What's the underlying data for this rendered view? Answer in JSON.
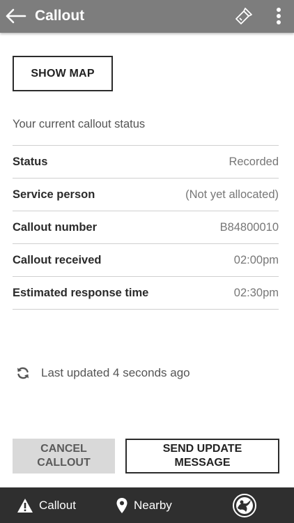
{
  "app_bar": {
    "title": "Callout",
    "back_icon": "arrow-left-icon",
    "torch_icon": "flashlight-icon",
    "more_icon": "more-vert-icon",
    "background": "#7d7d7d"
  },
  "actions": {
    "show_map": "SHOW MAP",
    "cancel_callout": "CANCEL\nCALLOUT",
    "send_update": "SEND UPDATE\nMESSAGE"
  },
  "status": {
    "intro": "Your current callout status",
    "rows": [
      {
        "label": "Status",
        "value": "Recorded"
      },
      {
        "label": "Service person",
        "value": "(Not yet allocated)"
      },
      {
        "label": "Callout number",
        "value": "B84800010"
      },
      {
        "label": "Callout received",
        "value": "02:00pm"
      },
      {
        "label": "Estimated response time",
        "value": "02:30pm"
      }
    ]
  },
  "last_updated": {
    "icon": "refresh-icon",
    "text": "Last updated 4 seconds ago"
  },
  "bottom_nav": {
    "background": "#2f2f2f",
    "items": [
      {
        "label": "Callout",
        "icon": "warning-icon"
      },
      {
        "label": "Nearby",
        "icon": "location-pin-icon"
      }
    ],
    "brand_icon": "holden-logo-icon"
  }
}
